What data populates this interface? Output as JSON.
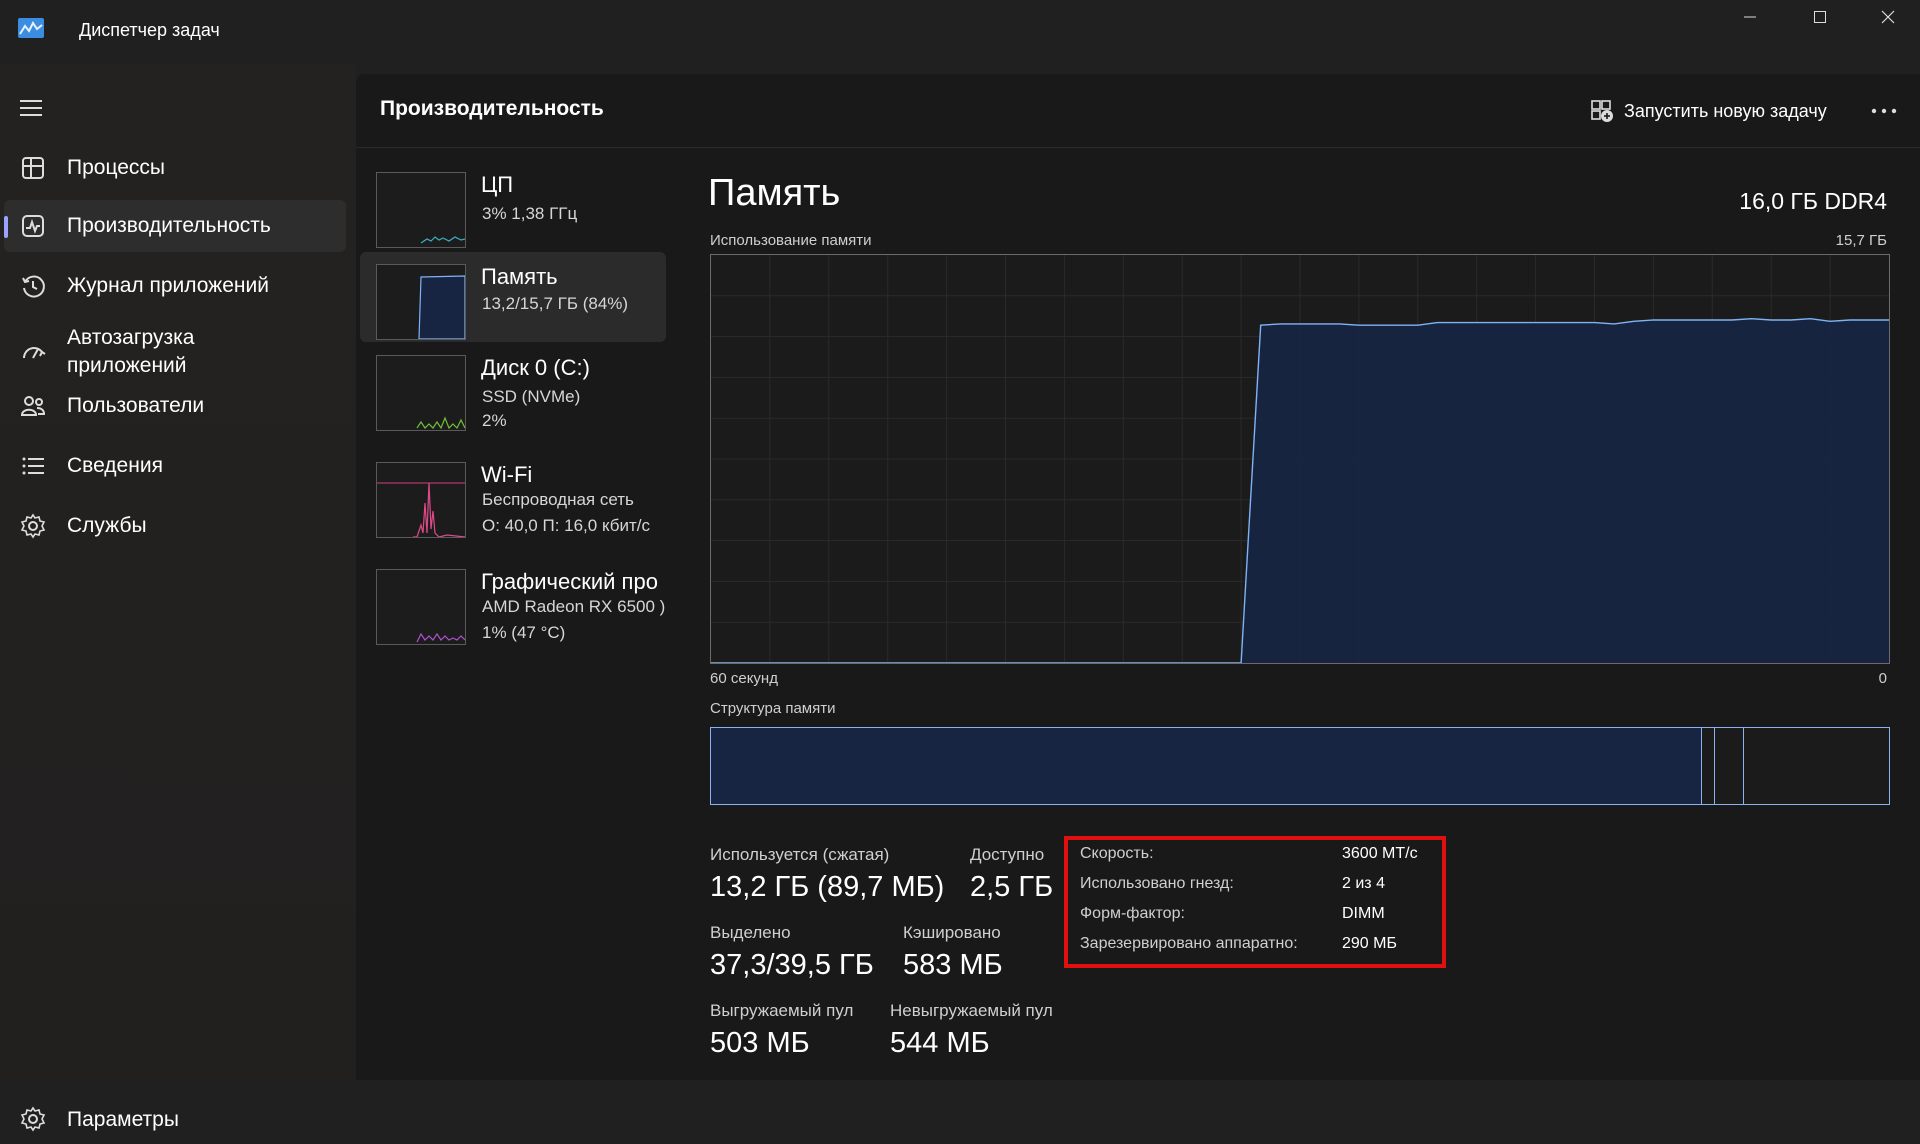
{
  "window": {
    "title": "Диспетчер задач"
  },
  "sidebar": {
    "items": [
      {
        "label": "Процессы",
        "icon": "processes-icon"
      },
      {
        "label": "Производительность",
        "icon": "performance-icon",
        "active": true
      },
      {
        "label": "Журнал приложений",
        "icon": "history-icon"
      },
      {
        "label": "Автозагрузка\nприложений",
        "icon": "startup-icon"
      },
      {
        "label": "Пользователи",
        "icon": "users-icon"
      },
      {
        "label": "Сведения",
        "icon": "details-icon"
      },
      {
        "label": "Службы",
        "icon": "services-icon"
      }
    ],
    "settings_label": "Параметры"
  },
  "header": {
    "title": "Производительность",
    "run_task_label": "Запустить новую задачу"
  },
  "perf_list": [
    {
      "name": "ЦП",
      "sub1": "3%  1,38 ГГц",
      "sub2": ""
    },
    {
      "name": "Память",
      "sub1": "13,2/15,7 ГБ (84%)",
      "sub2": ""
    },
    {
      "name": "Диск 0 (C:)",
      "sub1": "SSD (NVMe)",
      "sub2": "2%"
    },
    {
      "name": "Wi-Fi",
      "sub1": "Беспроводная сеть",
      "sub2": "О: 40,0  П: 16,0 кбит/с"
    },
    {
      "name": "Графический про",
      "sub1": "AMD Radeon RX 6500 )",
      "sub2": "1% (47 °C)"
    }
  ],
  "memory": {
    "title": "Память",
    "total": "16,0 ГБ DDR4",
    "usage_label": "Использование памяти",
    "usage_max": "15,7 ГБ",
    "time_left": "60 секунд",
    "time_right": "0",
    "composition_label": "Структура памяти"
  },
  "stats": {
    "in_use_label": "Используется (сжатая)",
    "in_use_value": "13,2 ГБ (89,7 МБ)",
    "available_label": "Доступно",
    "available_value": "2,5 ГБ",
    "committed_label": "Выделено",
    "committed_value": "37,3/39,5 ГБ",
    "cached_label": "Кэшировано",
    "cached_value": "583 МБ",
    "paged_label": "Выгружаемый пул",
    "paged_value": "503 МБ",
    "nonpaged_label": "Невыгружаемый пул",
    "nonpaged_value": "544 МБ"
  },
  "specs": {
    "speed_label": "Скорость:",
    "speed_value": "3600 МТ/с",
    "slots_label": "Использовано гнезд:",
    "slots_value": "2 из 4",
    "form_label": "Форм-фактор:",
    "form_value": "DIMM",
    "reserved_label": "Зарезервировано аппаратно:",
    "reserved_value": "290 МБ"
  },
  "chart_data": {
    "type": "area",
    "title": "Использование памяти",
    "xlabel": "",
    "ylabel": "",
    "x_range_label": [
      "60 секунд",
      "0"
    ],
    "ylim": [
      0,
      15.7
    ],
    "series": [
      {
        "values": [
          0,
          0,
          0,
          0,
          0,
          0,
          0,
          0,
          0,
          0,
          0,
          0,
          0,
          0,
          0,
          0,
          0,
          0,
          0,
          0,
          0,
          0,
          0,
          0,
          0,
          0,
          0,
          0,
          13.0,
          13.05,
          13.05,
          13.05,
          13.05,
          13.0,
          13.0,
          13.0,
          13.0,
          13.1,
          13.1,
          13.1,
          13.1,
          13.1,
          13.1,
          13.1,
          13.1,
          13.1,
          13.05,
          13.15,
          13.2,
          13.2,
          13.2,
          13.2,
          13.2,
          13.25,
          13.2,
          13.2,
          13.25,
          13.15,
          13.2,
          13.2,
          13.2
        ]
      }
    ]
  },
  "colors": {
    "accent": "#9aa4ff",
    "memory_line": "#7fb3f5",
    "memory_fill": "#172542",
    "highlight": "#e01010"
  }
}
